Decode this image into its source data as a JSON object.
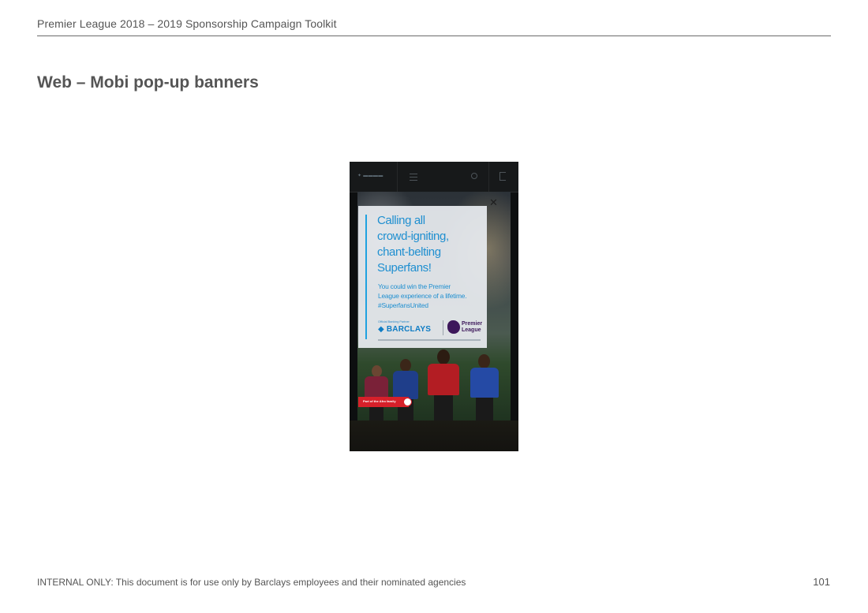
{
  "document": {
    "header": "Premier League 2018 – 2019 Sponsorship Campaign Toolkit",
    "title": "Web – Mobi pop-up banners",
    "footer": "INTERNAL ONLY: This document is for use only by Barclays employees and their nominated agencies",
    "page_number": "101"
  },
  "banner": {
    "headline_lines": [
      "Calling all",
      "crowd-igniting,",
      "chant-belting",
      "Superfans!"
    ],
    "body_lines": [
      "You could win the Premier",
      "League experience of a lifetime.",
      "#SuperfansUnited"
    ],
    "partner_caption": "Official Banking Partner",
    "barclays_logo": "BARCLAYS",
    "pl_logo_line1": "Premier",
    "pl_logo_line2": "League",
    "afro_text": "Part of the Afro family",
    "close_glyph": "✕",
    "colors": {
      "headline": "#1f8fd0",
      "accent_bar": "#1fa2e0",
      "barclays_blue": "#0e7cc4",
      "premier_league_purple": "#3d185b",
      "afro_red": "#d6202a"
    },
    "icons": [
      "hamburger-menu-icon",
      "search-icon",
      "logout-icon",
      "close-icon",
      "premier-league-lion-icon",
      "barclays-eagle-icon"
    ]
  }
}
